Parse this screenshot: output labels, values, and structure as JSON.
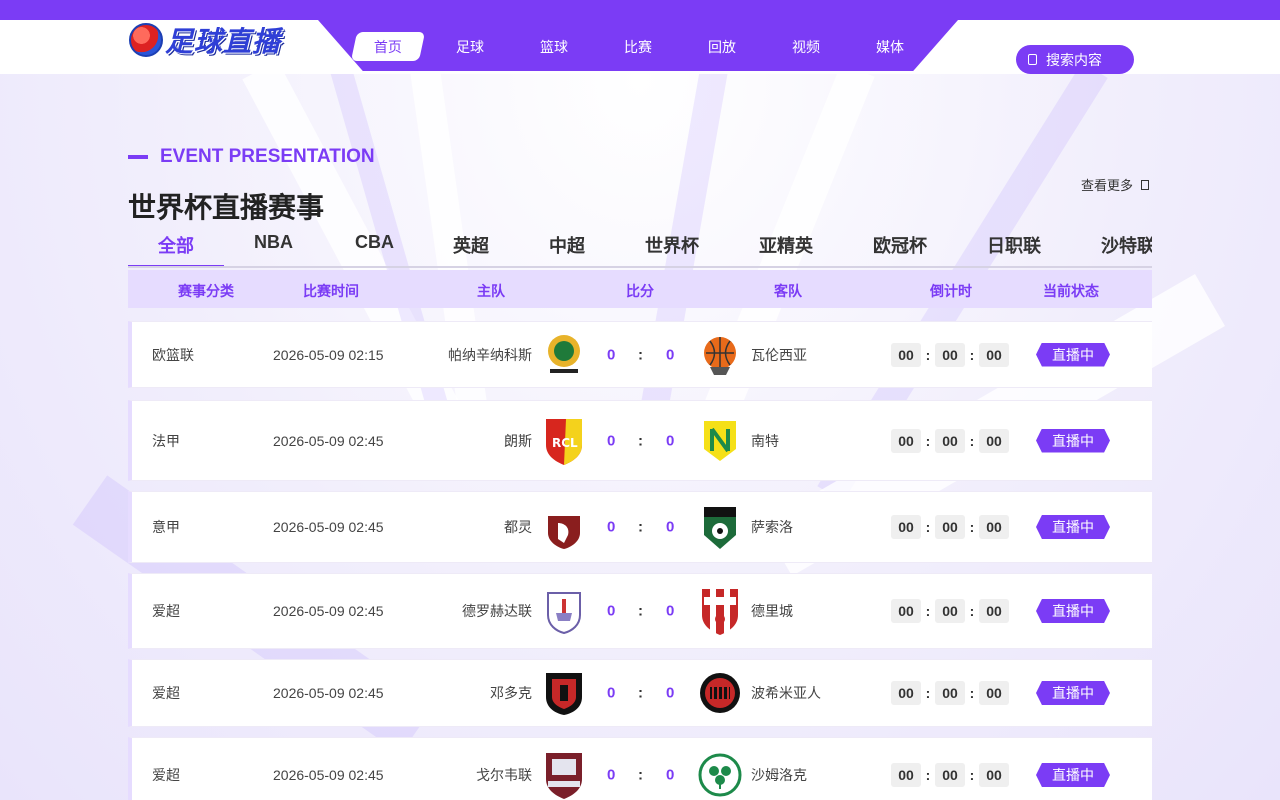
{
  "brand": {
    "logo_text": "足球直播"
  },
  "nav": {
    "items": [
      "首页",
      "足球",
      "篮球",
      "比赛",
      "回放",
      "视频",
      "媒体"
    ],
    "active_index": 0
  },
  "search": {
    "placeholder": "搜索内容"
  },
  "section": {
    "tag": "EVENT PRESENTATION",
    "title": "世界杯直播赛事",
    "more_label": "查看更多"
  },
  "tabs": {
    "items": [
      "全部",
      "NBA",
      "CBA",
      "英超",
      "中超",
      "世界杯",
      "亚精英",
      "欧冠杯",
      "日职联",
      "沙特联"
    ],
    "active_index": 0
  },
  "table": {
    "headers": {
      "category": "赛事分类",
      "time": "比赛时间",
      "home": "主队",
      "score": "比分",
      "away": "客队",
      "countdown": "倒计时",
      "status": "当前状态"
    },
    "rows": [
      {
        "league": "欧篮联",
        "time": "2026-05-09 02:15",
        "home": "帕纳辛纳科斯",
        "home_crest": "panathinaikos-crest",
        "home_score": "0",
        "colon": ":",
        "away_score": "0",
        "away": "瓦伦西亚",
        "away_crest": "valencia-crest",
        "cd": [
          "00",
          "00",
          "00"
        ],
        "status": "直播中"
      },
      {
        "league": "法甲",
        "time": "2026-05-09 02:45",
        "home": "朗斯",
        "home_crest": "lens-crest",
        "home_score": "0",
        "colon": ":",
        "away_score": "0",
        "away": "南特",
        "away_crest": "nantes-crest",
        "cd": [
          "00",
          "00",
          "00"
        ],
        "status": "直播中"
      },
      {
        "league": "意甲",
        "time": "2026-05-09 02:45",
        "home": "都灵",
        "home_crest": "torino-crest",
        "home_score": "0",
        "colon": ":",
        "away_score": "0",
        "away": "萨索洛",
        "away_crest": "sassuolo-crest",
        "cd": [
          "00",
          "00",
          "00"
        ],
        "status": "直播中"
      },
      {
        "league": "爱超",
        "time": "2026-05-09 02:45",
        "home": "德罗赫达联",
        "home_crest": "drogheda-crest",
        "home_score": "0",
        "colon": ":",
        "away_score": "0",
        "away": "德里城",
        "away_crest": "derry-crest",
        "cd": [
          "00",
          "00",
          "00"
        ],
        "status": "直播中"
      },
      {
        "league": "爱超",
        "time": "2026-05-09 02:45",
        "home": "邓多克",
        "home_crest": "dundalk-crest",
        "home_score": "0",
        "colon": ":",
        "away_score": "0",
        "away": "波希米亚人",
        "away_crest": "bohemians-crest",
        "cd": [
          "00",
          "00",
          "00"
        ],
        "status": "直播中"
      },
      {
        "league": "爱超",
        "time": "2026-05-09 02:45",
        "home": "戈尔韦联",
        "home_crest": "galway-crest",
        "home_score": "0",
        "colon": ":",
        "away_score": "0",
        "away": "沙姆洛克",
        "away_crest": "shamrock-crest",
        "cd": [
          "00",
          "00",
          "00"
        ],
        "status": "直播中"
      }
    ]
  }
}
